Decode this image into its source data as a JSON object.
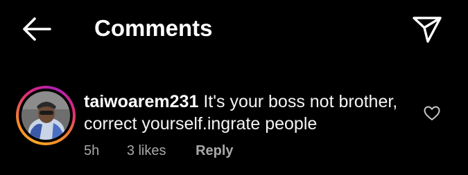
{
  "header": {
    "title": "Comments",
    "back_icon": "arrow-left-icon",
    "share_icon": "paper-plane-icon"
  },
  "comment": {
    "username": "taiwoarem231",
    "text": "It's your boss not brother, correct yourself.ingrate people",
    "time": "5h",
    "likes": "3 likes",
    "reply_label": "Reply",
    "like_icon": "heart-icon"
  },
  "colors": {
    "background": "#000000",
    "text": "#ffffff",
    "muted": "#a8a8a8",
    "ring_gradient": [
      "#f9a825",
      "#f58529",
      "#dd2a7b",
      "#b01fb5"
    ]
  }
}
